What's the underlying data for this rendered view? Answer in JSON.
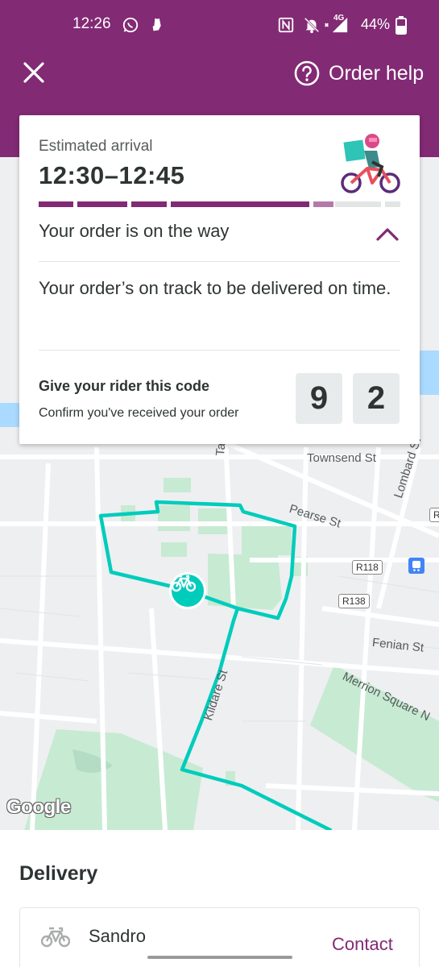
{
  "status_bar": {
    "time": "12:26",
    "network": "4G",
    "battery": "44%"
  },
  "header": {
    "close_icon": "close-icon",
    "help_label": "Order help",
    "help_icon": "question-circle-icon"
  },
  "map": {
    "street_labels": [
      "Townsend St",
      "Pearse St",
      "Lombard St",
      "Fenian St",
      "Merrion Square N",
      "Kildare St",
      "Ta"
    ],
    "road_badges": [
      "R118",
      "R138",
      "R"
    ],
    "attribution": "Google",
    "route_color": "#00ccbc",
    "rider_marker_icon": "bicycle-icon"
  },
  "tracking_card": {
    "eta_label": "Estimated arrival",
    "eta_value": "12:30–12:45",
    "status_title": "Your order is on the way",
    "status_detail": "Your order’s on track to be delivered on time.",
    "code_title": "Give your rider this code",
    "code_subtitle": "Confirm you've received your order",
    "code_digits": [
      "9",
      "2"
    ],
    "progress": {
      "segments_completed": 4,
      "segment_in_progress": 5,
      "segments_total": 7
    }
  },
  "delivery": {
    "heading": "Delivery",
    "rider_name": "Sandro",
    "contact_label": "Contact"
  },
  "colors": {
    "brand": "#822a74",
    "accent": "#00ccbc",
    "text": "#2e3333",
    "park": "#c7ead3"
  }
}
